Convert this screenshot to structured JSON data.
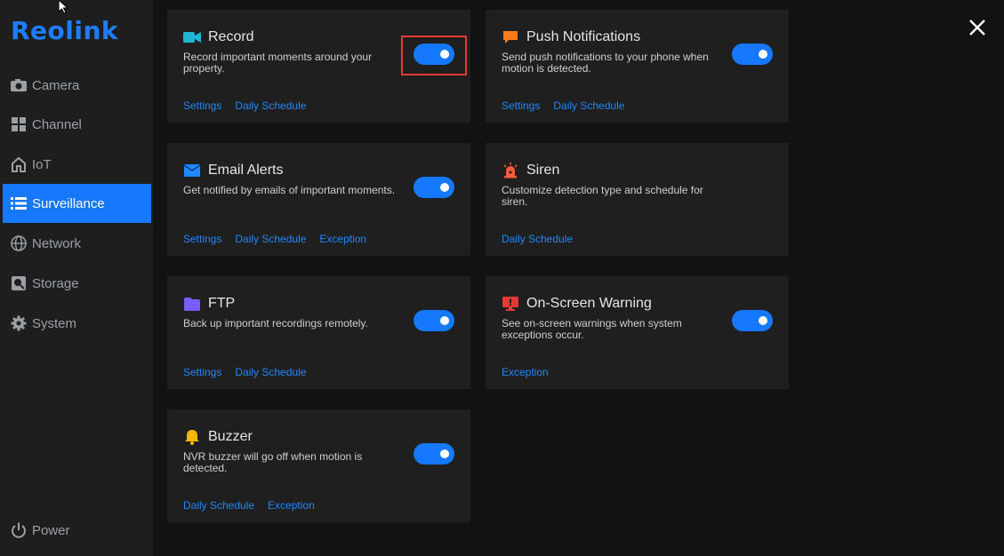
{
  "brand": {
    "logo_text": "Reolink",
    "accent": "#1677ff"
  },
  "sidebar": {
    "items": [
      {
        "label": "Camera",
        "icon": "camera-icon",
        "active": false
      },
      {
        "label": "Channel",
        "icon": "grid-icon",
        "active": false
      },
      {
        "label": "IoT",
        "icon": "home-icon",
        "active": false
      },
      {
        "label": "Surveillance",
        "icon": "list-icon",
        "active": true
      },
      {
        "label": "Network",
        "icon": "globe-icon",
        "active": false
      },
      {
        "label": "Storage",
        "icon": "storage-icon",
        "active": false
      },
      {
        "label": "System",
        "icon": "gear-icon",
        "active": false
      }
    ],
    "power_label": "Power"
  },
  "cards": {
    "record": {
      "title": "Record",
      "icon": "video-camera-icon",
      "icon_color": "#1fb6d6",
      "description": "Record important moments around your property.",
      "toggle_on": true,
      "links": [
        "Settings",
        "Daily Schedule"
      ]
    },
    "push": {
      "title": "Push Notifications",
      "icon": "message-icon",
      "icon_color": "#ff7a1a",
      "description": "Send push notifications to your phone when motion is detected.",
      "toggle_on": true,
      "links": [
        "Settings",
        "Daily Schedule"
      ]
    },
    "email": {
      "title": "Email Alerts",
      "icon": "mail-icon",
      "icon_color": "#1e88ff",
      "description": "Get notified by emails of important moments.",
      "toggle_on": true,
      "links": [
        "Settings",
        "Daily Schedule",
        "Exception"
      ]
    },
    "siren": {
      "title": "Siren",
      "icon": "siren-icon",
      "icon_color": "#ff5a3c",
      "description": "Customize detection type and schedule for siren.",
      "toggle_on": false,
      "links": [
        "Daily Schedule"
      ]
    },
    "ftp": {
      "title": "FTP",
      "icon": "folder-icon",
      "icon_color": "#7a5cff",
      "description": "Back up important recordings remotely.",
      "toggle_on": true,
      "links": [
        "Settings",
        "Daily Schedule"
      ]
    },
    "warning": {
      "title": "On-Screen Warning",
      "icon": "monitor-warning-icon",
      "icon_color": "#e53935",
      "description": "See on-screen warnings when system exceptions occur.",
      "toggle_on": true,
      "links": [
        "Exception"
      ]
    },
    "buzzer": {
      "title": "Buzzer",
      "icon": "bell-icon",
      "icon_color": "#f5b800",
      "description": "NVR buzzer will go off when motion is detected.",
      "toggle_on": true,
      "links": [
        "Daily Schedule",
        "Exception"
      ]
    }
  }
}
